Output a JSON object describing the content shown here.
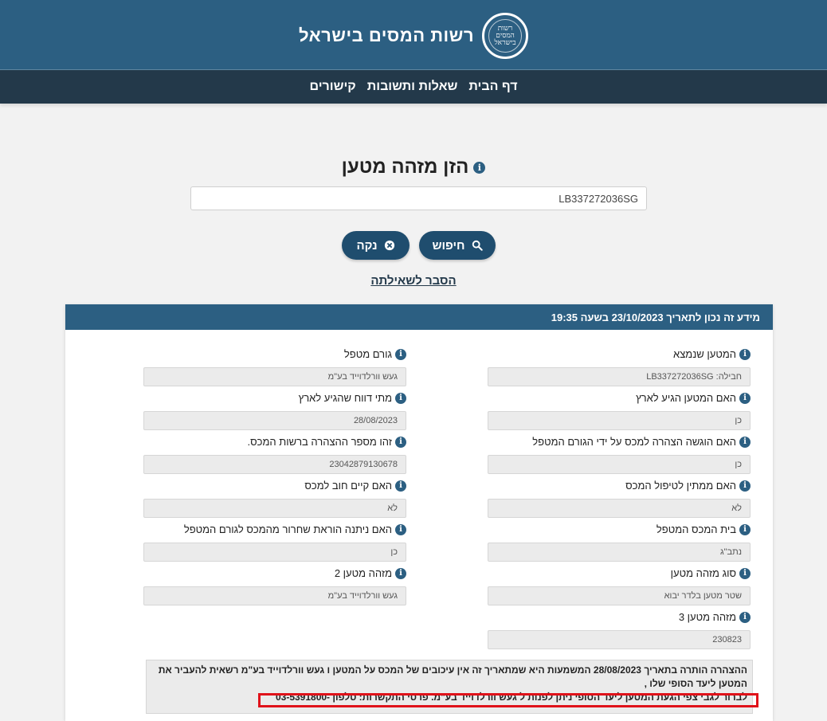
{
  "header": {
    "site_title": "רשות המסים בישראל",
    "logo_text": "רשות המסים בישראל"
  },
  "nav": {
    "items": [
      "דף הבית",
      "שאלות ותשובות",
      "קישורים"
    ]
  },
  "search": {
    "title": "הזן מזהה מטען",
    "value": "LB337272036SG",
    "search_label": "חיפוש",
    "clear_label": "נקה",
    "explain_link": "הסבר לשאילתה"
  },
  "result": {
    "header": "מידע זה נכון לתאריך 23/10/2023 בשעה 19:35",
    "right_fields": [
      {
        "label": "המטען שנמצא",
        "value": "חבילה: LB337272036SG"
      },
      {
        "label": "האם המטען הגיע לארץ",
        "value": "כן"
      },
      {
        "label": "האם הוגשה הצהרה למכס על ידי הגורם המטפל",
        "value": "כן"
      },
      {
        "label": "האם ממתין לטיפול המכס",
        "value": "לא"
      },
      {
        "label": "בית המכס המטפל",
        "value": "נתב\"ג"
      },
      {
        "label": "סוג מזהה מטען",
        "value": "שטר מטען בלדר יבוא"
      },
      {
        "label": "מזהה מטען 3",
        "value": "230823"
      }
    ],
    "left_fields": [
      {
        "label": "גורם מטפל",
        "value": "געש וורלדוייד בע\"מ"
      },
      {
        "label": "מתי דווח שהגיע לארץ",
        "value": "28/08/2023"
      },
      {
        "label": "זהו מספר ההצהרה ברשות המכס.",
        "value": "23042879130678"
      },
      {
        "label": "האם קיים חוב למכס",
        "value": "לא"
      },
      {
        "label": "האם ניתנה הוראת שחרור מהמכס לגורם המטפל",
        "value": "כן"
      },
      {
        "label": "מזהה מטען 2",
        "value": "געש וורלדוייד בע\"מ"
      }
    ],
    "notice": {
      "line1": "ההצהרה הותרה בתאריך 28/08/2023 המשמעות היא שמתאריך זה אין עיכובים של המכס על המטען ו געש וורלדוייד בע\"מ רשאית להעביר את המטען ליעד הסופי שלו ,",
      "line2": "לברור לגבי צפי הגעת המטען ליעד הסופי ניתן לפנות ל געש וורלדוייד בע\"מ. פרטי התקשרות: טלפון -03-5391800"
    }
  },
  "colors": {
    "header_bg": "#2c5f82",
    "nav_bg": "#23394a",
    "button_bg": "#1f4d6e",
    "highlight_border": "#e0121a"
  }
}
